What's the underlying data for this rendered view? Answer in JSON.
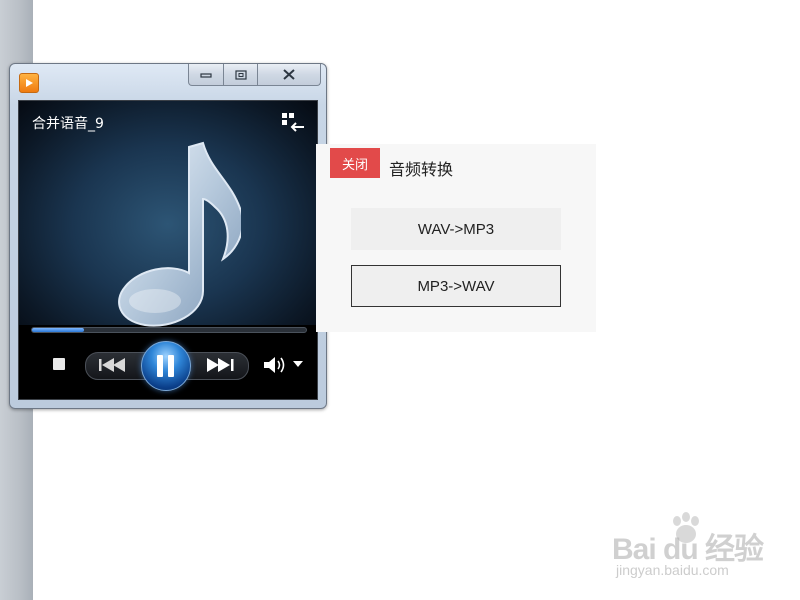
{
  "player": {
    "track_title": "合并语音_9",
    "progress": 0.19,
    "icons": {
      "app": "media-player-icon",
      "switch_view": "switch-to-library-icon",
      "stop": "stop-icon",
      "prev": "previous-icon",
      "pause": "pause-icon",
      "next": "next-icon",
      "volume": "volume-icon",
      "volume_menu": "chevron-down-icon"
    }
  },
  "converter": {
    "close_label": "关闭",
    "title": "音频转换",
    "buttons": [
      "WAV->MP3",
      "MP3->WAV"
    ],
    "accent_color": "#e24a4a"
  },
  "watermark": {
    "brand_text": "Bai du 经验",
    "url": "jingyan.baidu.com"
  }
}
